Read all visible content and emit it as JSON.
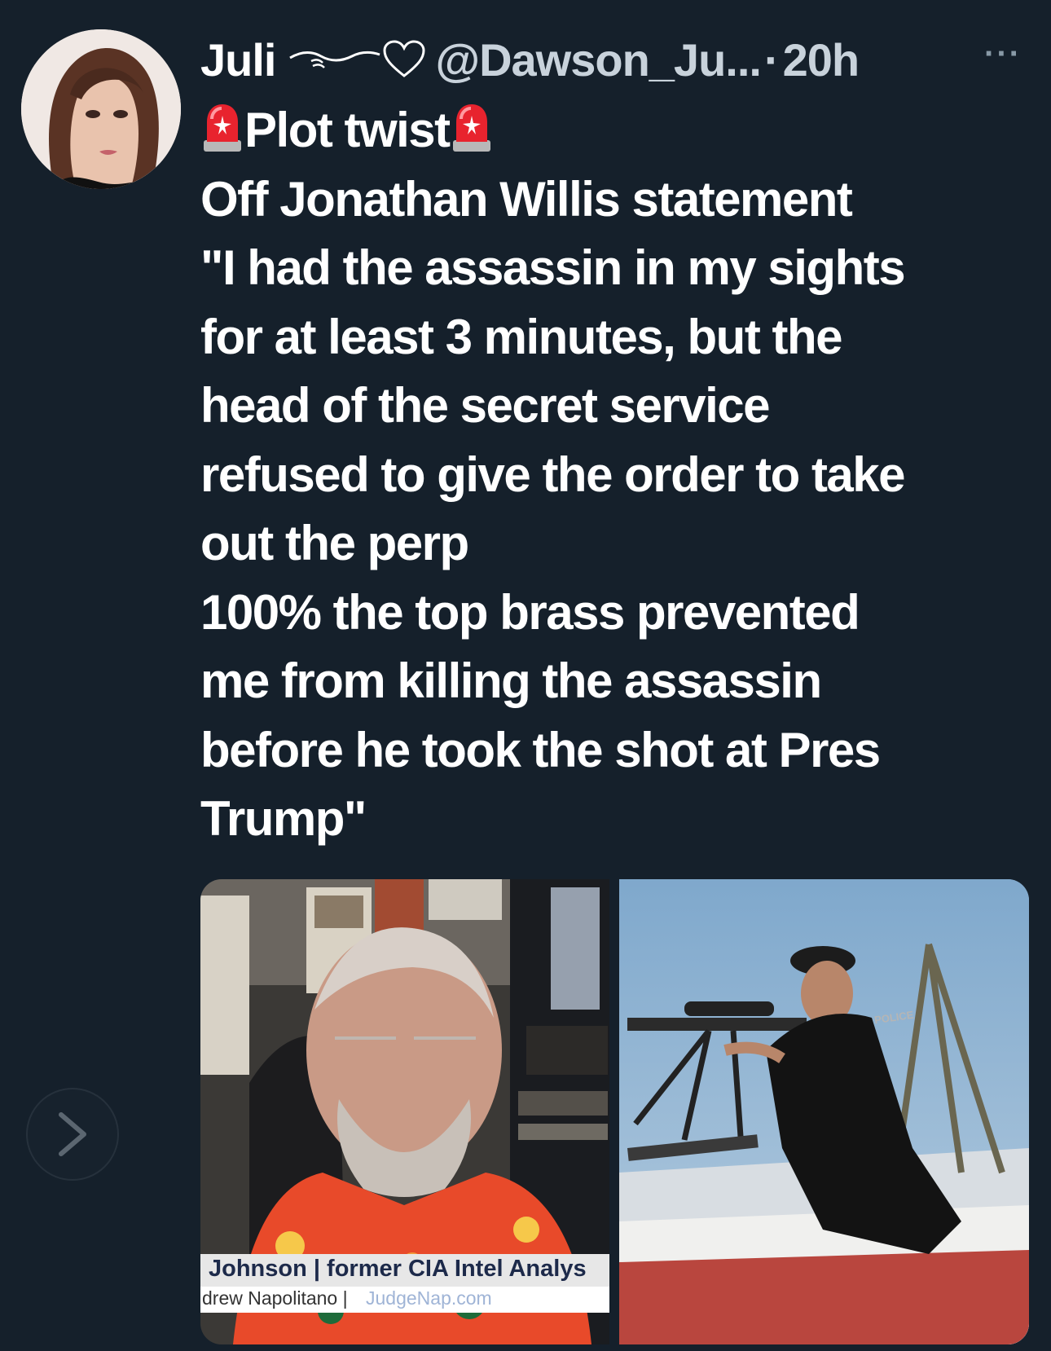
{
  "tweet": {
    "display_name": "Juli",
    "name_decoration_icons": [
      "wave-swirl-icon",
      "heart-outline-icon"
    ],
    "handle": "@Dawson_Ju...",
    "separator": "·",
    "timestamp": "20h",
    "more_label": "···",
    "text_lines": [
      "Plot twist",
      "Off Jonathan Willis statement",
      "\"I had the assassin in my sights",
      "for at least 3 minutes, but the",
      "head of the secret service",
      "refused to give the order to take",
      "out the perp",
      "100% the top brass prevented",
      "me from killing the assassin",
      "before he took the shot at Pres",
      "Trump\""
    ],
    "first_line_icons": [
      "siren-emoji-icon",
      "siren-emoji-icon"
    ]
  },
  "media": {
    "left_photo": {
      "lower_third_line1": "Johnson | former CIA Intel Analys",
      "lower_third_line2_name": "drew Napolitano |",
      "lower_third_line2_site": "JudgeNap.com"
    },
    "right_photo": {
      "vest_label": "POLICE"
    }
  },
  "navigation": {
    "next_icon": "chevron-right-icon"
  },
  "colors": {
    "background": "#15202b",
    "text_primary": "#ffffff",
    "text_secondary": "#c8d2db"
  }
}
